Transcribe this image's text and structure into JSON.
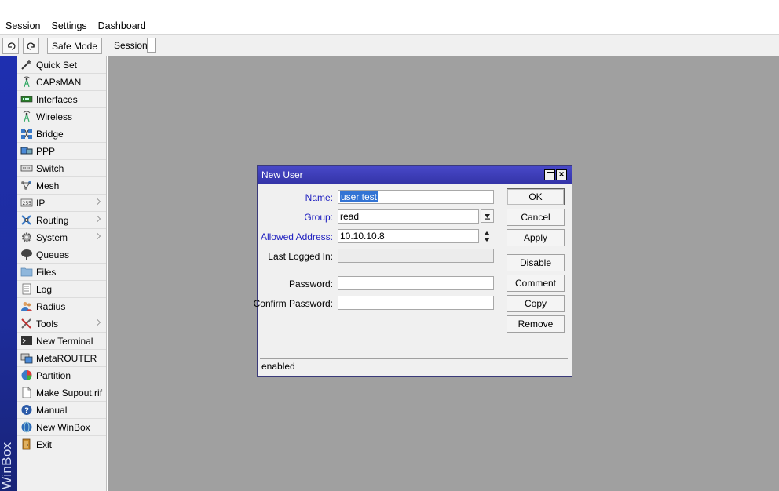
{
  "menubar": {
    "items": [
      "Session",
      "Settings",
      "Dashboard"
    ]
  },
  "toolbar": {
    "undo_icon": "undo-icon",
    "redo_icon": "redo-icon",
    "safe_mode_label": "Safe Mode",
    "session_label": "Session:",
    "session_value": ""
  },
  "brand": {
    "vertical_label": "WinBox"
  },
  "sidebar": {
    "items": [
      {
        "label": "Quick Set",
        "icon": "wand-icon",
        "submenu": false
      },
      {
        "label": "CAPsMAN",
        "icon": "antenna-icon",
        "submenu": false
      },
      {
        "label": "Interfaces",
        "icon": "interfaces-icon",
        "submenu": false
      },
      {
        "label": "Wireless",
        "icon": "antenna-icon",
        "submenu": false
      },
      {
        "label": "Bridge",
        "icon": "bridge-icon",
        "submenu": false
      },
      {
        "label": "PPP",
        "icon": "ppp-icon",
        "submenu": false
      },
      {
        "label": "Switch",
        "icon": "switch-icon",
        "submenu": false
      },
      {
        "label": "Mesh",
        "icon": "mesh-icon",
        "submenu": false
      },
      {
        "label": "IP",
        "icon": "ip-icon",
        "submenu": true
      },
      {
        "label": "Routing",
        "icon": "routing-icon",
        "submenu": true
      },
      {
        "label": "System",
        "icon": "gear-icon",
        "submenu": true
      },
      {
        "label": "Queues",
        "icon": "queues-icon",
        "submenu": false
      },
      {
        "label": "Files",
        "icon": "folder-icon",
        "submenu": false
      },
      {
        "label": "Log",
        "icon": "log-icon",
        "submenu": false
      },
      {
        "label": "Radius",
        "icon": "users-icon",
        "submenu": false
      },
      {
        "label": "Tools",
        "icon": "tools-icon",
        "submenu": true
      },
      {
        "label": "New Terminal",
        "icon": "terminal-icon",
        "submenu": false
      },
      {
        "label": "MetaROUTER",
        "icon": "metarouter-icon",
        "submenu": false
      },
      {
        "label": "Partition",
        "icon": "pie-icon",
        "submenu": false
      },
      {
        "label": "Make Supout.rif",
        "icon": "file-icon",
        "submenu": false
      },
      {
        "label": "Manual",
        "icon": "help-icon",
        "submenu": false
      },
      {
        "label": "New WinBox",
        "icon": "globe-icon",
        "submenu": false
      },
      {
        "label": "Exit",
        "icon": "exit-icon",
        "submenu": false
      }
    ]
  },
  "dialog": {
    "title": "New User",
    "fields": {
      "name_label": "Name:",
      "name_value": "user test",
      "group_label": "Group:",
      "group_value": "read",
      "allowed_label": "Allowed Address:",
      "allowed_value": "10.10.10.8",
      "last_logged_label": "Last Logged In:",
      "last_logged_value": "",
      "password_label": "Password:",
      "password_value": "",
      "confirm_label": "Confirm Password:",
      "confirm_value": ""
    },
    "buttons": {
      "ok": "OK",
      "cancel": "Cancel",
      "apply": "Apply",
      "disable": "Disable",
      "comment": "Comment",
      "copy": "Copy",
      "remove": "Remove"
    },
    "status": "enabled"
  },
  "colors": {
    "title_bar": "#3a3aa8",
    "workspace": "#a0a0a0",
    "brand_strip": "#1e2fb0",
    "label_blue": "#2020c0",
    "selection": "#3374d4"
  }
}
